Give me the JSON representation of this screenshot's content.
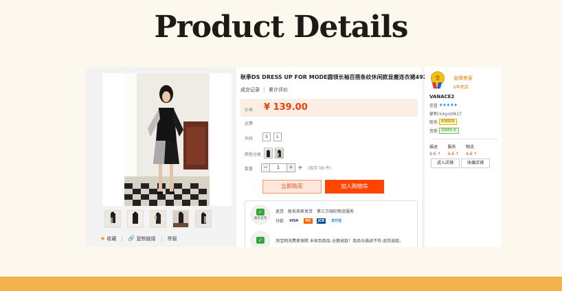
{
  "page": {
    "title": "Product Details"
  },
  "product": {
    "title": "秋季DS DRESS UP FOR MODE圆领长袖百搭条纹休闲款显瘦连衣裙4929",
    "tabs": [
      "成交记录",
      "累计评价"
    ],
    "price_label": "价格",
    "price": "¥ 139.00",
    "shipping_label": "运费",
    "size_label": "尺码",
    "sizes": [
      "S",
      "L"
    ],
    "color_label": "颜色分类",
    "qty_label": "数量",
    "qty_value": "1",
    "qty_minus": "−",
    "qty_plus": "+",
    "qty_unit": "件",
    "qty_stock": "(库存 99 件)",
    "buy_now": "立即购买",
    "add_cart": "加入购物车"
  },
  "gallery": {
    "thumbnail_count": 5
  },
  "actions": {
    "favorite": "收藏",
    "copy_link": "复制链接",
    "report": "举报"
  },
  "service": {
    "support_caption": "服务支持",
    "line1": [
      "退货",
      "联系卖家发货",
      "第三方国际物流服务"
    ],
    "pay_label": "付款",
    "pay_methods": [
      "VISA",
      "MC",
      "JCB",
      "支付宝"
    ],
    "line3": "淘宝网消费者保障    未收到商品-全额退款！商品与描述不符-退货退款。"
  },
  "seller": {
    "medal": "金",
    "level": "金牌卖家",
    "years": "6年老店",
    "shop": "VANACE2",
    "credit_label": "信誉",
    "credit_diamonds": 5,
    "keeper": "掌柜rickyni0617",
    "contact_label": "联系",
    "contact_badge": "和我联系",
    "deposit_label": "资质",
    "deposit_badge": "10000 元",
    "scores": [
      {
        "label": "描述",
        "value": "4.6 ↑"
      },
      {
        "label": "服务",
        "value": "4.6 ↑"
      },
      {
        "label": "物流",
        "value": "4.6 ↑"
      }
    ],
    "enter_shop": "进入店铺",
    "favorite_shop": "收藏店铺"
  },
  "colors": {
    "accent": "#ff4400",
    "price": "#f23b08",
    "bar": "#f2b44a",
    "bg": "#fdf8ee"
  }
}
